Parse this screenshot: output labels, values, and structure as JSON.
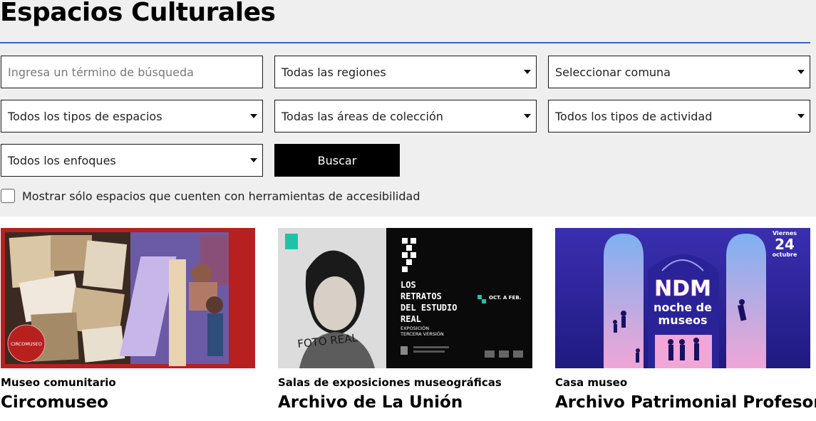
{
  "page": {
    "title": "Espacios Culturales",
    "accent_color": "#3366cc"
  },
  "filters": {
    "search": {
      "placeholder": "Ingresa un término de búsqueda",
      "value": ""
    },
    "region": "Todas las regiones",
    "comuna": "Seleccionar comuna",
    "space_type": "Todos los tipos de espacios",
    "collection_area": "Todas las áreas de colección",
    "activity_type": "Todos los tipos de actividad",
    "approach": "Todos los enfoques",
    "search_button": "Buscar",
    "accessibility_checkbox": {
      "label": "Mostrar sólo espacios que cuenten con herramientas de accesibilidad",
      "checked": false
    }
  },
  "results": [
    {
      "category": "Museo comunitario",
      "name": "Circomuseo",
      "image": {
        "logo_text": "CIRCOMUSEO"
      }
    },
    {
      "category": "Salas de exposiciones museográficas",
      "name": "Archivo de La Unión",
      "image": {
        "headline": [
          "LOS",
          "RETRATOS",
          "DEL ESTUDIO",
          "REAL"
        ],
        "subline": [
          "EXPOSICIÓN",
          "TERCERA VERSIÓN"
        ],
        "date_text": "OCT. A FEB.",
        "photo_caption": "FOTO REAL"
      }
    },
    {
      "category": "Casa museo",
      "name": "Archivo Patrimonial Profesor",
      "image": {
        "logo": "NDM",
        "logo_sub": [
          "noche de",
          "museos"
        ],
        "date_day": "Viernes",
        "date_num": "24",
        "date_month": "octubre"
      }
    }
  ]
}
